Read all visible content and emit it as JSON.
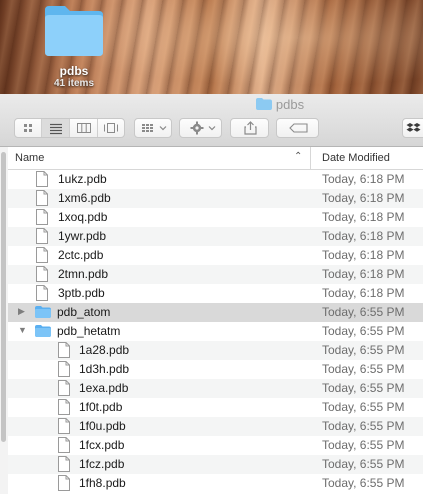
{
  "desktop": {
    "folder_name": "pdbs",
    "folder_count": "41 items",
    "folder_icon": "folder-icon"
  },
  "window": {
    "title": "pdbs",
    "title_icon": "folder-icon",
    "toolbar": {
      "view_icons": [
        "icon-view-icon",
        "list-view-icon",
        "column-view-icon",
        "cover-flow-icon"
      ],
      "arrange_icon": "arrange-icon",
      "action_icon": "gear-icon",
      "share_icon": "share-icon",
      "tag_icon": "tag-icon",
      "dropbox_icon": "dropbox-icon"
    },
    "columns": {
      "name": "Name",
      "date": "Date Modified"
    },
    "rows": [
      {
        "name": "1ukz.pdb",
        "date": "Today, 6:18 PM",
        "kind": "file",
        "level": 1
      },
      {
        "name": "1xm6.pdb",
        "date": "Today, 6:18 PM",
        "kind": "file",
        "level": 1
      },
      {
        "name": "1xoq.pdb",
        "date": "Today, 6:18 PM",
        "kind": "file",
        "level": 1
      },
      {
        "name": "1ywr.pdb",
        "date": "Today, 6:18 PM",
        "kind": "file",
        "level": 1
      },
      {
        "name": "2ctc.pdb",
        "date": "Today, 6:18 PM",
        "kind": "file",
        "level": 1
      },
      {
        "name": "2tmn.pdb",
        "date": "Today, 6:18 PM",
        "kind": "file",
        "level": 1
      },
      {
        "name": "3ptb.pdb",
        "date": "Today, 6:18 PM",
        "kind": "file",
        "level": 1
      },
      {
        "name": "pdb_atom",
        "date": "Today, 6:55 PM",
        "kind": "folder",
        "expanded": false,
        "level": 0
      },
      {
        "name": "pdb_hetatm",
        "date": "Today, 6:55 PM",
        "kind": "folder",
        "expanded": true,
        "level": 0
      },
      {
        "name": "1a28.pdb",
        "date": "Today, 6:55 PM",
        "kind": "file",
        "level": 2
      },
      {
        "name": "1d3h.pdb",
        "date": "Today, 6:55 PM",
        "kind": "file",
        "level": 2
      },
      {
        "name": "1exa.pdb",
        "date": "Today, 6:55 PM",
        "kind": "file",
        "level": 2
      },
      {
        "name": "1f0t.pdb",
        "date": "Today, 6:55 PM",
        "kind": "file",
        "level": 2
      },
      {
        "name": "1f0u.pdb",
        "date": "Today, 6:55 PM",
        "kind": "file",
        "level": 2
      },
      {
        "name": "1fcx.pdb",
        "date": "Today, 6:55 PM",
        "kind": "file",
        "level": 2
      },
      {
        "name": "1fcz.pdb",
        "date": "Today, 6:55 PM",
        "kind": "file",
        "level": 2
      },
      {
        "name": "1fh8.pdb",
        "date": "Today, 6:55 PM",
        "kind": "file",
        "level": 2
      }
    ]
  }
}
